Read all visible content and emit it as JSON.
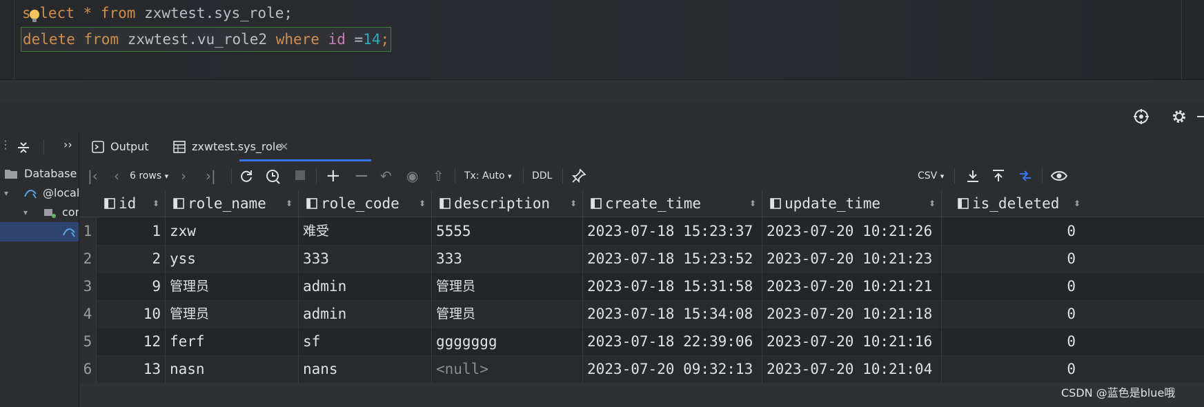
{
  "editor": {
    "line1": {
      "kw1": "select",
      "op": "*",
      "kw2": "from",
      "rest": "zxwtest.sys_role;"
    },
    "line2": {
      "kw1": "delete",
      "kw2": "from",
      "table": "zxwtest.vu_role2",
      "kw3": "where",
      "col": "id",
      "op": "=",
      "num": "14",
      "end": ";"
    }
  },
  "sidebar": {
    "database_label": "Database",
    "host_label": "@local",
    "schema_label": "cor"
  },
  "tabs": [
    {
      "label": "Output",
      "icon": "output-console-icon"
    },
    {
      "label": "zxwtest.sys_role",
      "icon": "table-grid-icon",
      "active": true
    }
  ],
  "toolbar": {
    "rows_label": "6 rows",
    "tx_label": "Tx: Auto",
    "ddl_label": "DDL",
    "csv_label": "CSV"
  },
  "table": {
    "columns": [
      "id",
      "role_name",
      "role_code",
      "description",
      "create_time",
      "update_time",
      "is_deleted"
    ],
    "rows": [
      {
        "n": "1",
        "id": "1",
        "role_name": "zxw",
        "role_code": "难受",
        "description": "5555",
        "create_time": "2023-07-18 15:23:37",
        "update_time": "2023-07-20 10:21:26",
        "is_deleted": "0"
      },
      {
        "n": "2",
        "id": "2",
        "role_name": "yss",
        "role_code": "333",
        "description": "333",
        "create_time": "2023-07-18 15:23:52",
        "update_time": "2023-07-20 10:21:23",
        "is_deleted": "0"
      },
      {
        "n": "3",
        "id": "9",
        "role_name": "管理员",
        "role_code": "admin",
        "description": "管理员",
        "create_time": "2023-07-18 15:31:58",
        "update_time": "2023-07-20 10:21:21",
        "is_deleted": "0"
      },
      {
        "n": "4",
        "id": "10",
        "role_name": "管理员",
        "role_code": "admin",
        "description": "管理员",
        "create_time": "2023-07-18 15:34:08",
        "update_time": "2023-07-20 10:21:18",
        "is_deleted": "0"
      },
      {
        "n": "5",
        "id": "12",
        "role_name": "ferf",
        "role_code": "sf",
        "description": "ggggggg",
        "create_time": "2023-07-18 22:39:06",
        "update_time": "2023-07-20 10:21:16",
        "is_deleted": "0"
      },
      {
        "n": "6",
        "id": "13",
        "role_name": "nasn",
        "role_code": "nans",
        "description": "<null>",
        "create_time": "2023-07-20 09:32:13",
        "update_time": "2023-07-20 10:21:04",
        "is_deleted": "0"
      }
    ]
  },
  "watermark": "CSDN @蓝色是blue哦",
  "colors": {
    "keyword": "#cf8e4d",
    "number": "#2aacb8",
    "accent": "#3574f0",
    "column_ref": "#c77dbb"
  }
}
